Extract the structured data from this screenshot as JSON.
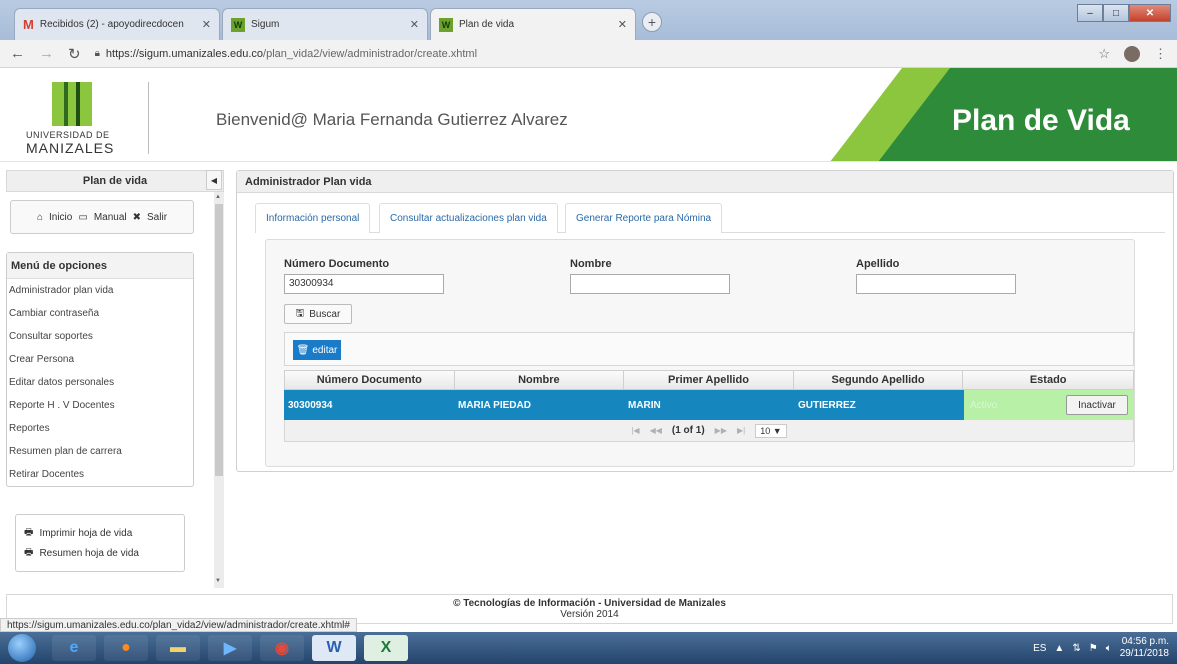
{
  "browser": {
    "tabs": [
      {
        "title": "Recibidos (2) - apoyodirecdocen"
      },
      {
        "title": "Sigum"
      },
      {
        "title": "Plan de vida"
      }
    ],
    "url_host": "https://sigum.umanizales.edu.co",
    "url_path": "/plan_vida2/view/administrador/create.xhtml"
  },
  "header": {
    "logo_line1": "UNIVERSIDAD DE",
    "logo_line2": "MANIZALES",
    "welcome": "Bienvenid@ Maria Fernanda Gutierrez Alvarez",
    "banner_title": "Plan de Vida"
  },
  "sidebar": {
    "title": "Plan de vida",
    "quick": {
      "inicio": "Inicio",
      "manual": "Manual",
      "salir": "Salir"
    },
    "menu_title": "Menú de opciones",
    "items": [
      "Administrador plan vida",
      "Cambiar contraseña",
      "Consultar soportes",
      "Crear Persona",
      "Editar datos personales",
      "Reporte H . V Docentes",
      "Reportes",
      "Resumen plan de carrera",
      "Retirar Docentes"
    ],
    "print_cv": "Imprimir hoja de vida",
    "summary_cv": "Resumen hoja de vida"
  },
  "panel": {
    "title": "Administrador Plan vida",
    "tabs": [
      "Información personal",
      "Consultar actualizaciones plan vida",
      "Generar Reporte para Nómina"
    ]
  },
  "form": {
    "doc_label": "Número Documento",
    "doc_value": "30300934",
    "name_label": "Nombre",
    "name_value": "",
    "surname_label": "Apellido",
    "surname_value": "",
    "search_label": "Buscar",
    "edit_label": "editar"
  },
  "table": {
    "columns": [
      "Número Documento",
      "Nombre",
      "Primer Apellido",
      "Segundo Apellido",
      "Estado"
    ],
    "rows": [
      {
        "documento": "30300934",
        "nombre": "MARIA PIEDAD",
        "primer_apellido": "MARIN",
        "segundo_apellido": "GUTIERREZ",
        "estado": "Activo",
        "action": "Inactivar"
      }
    ],
    "pager_text": "(1 of 1)",
    "rows_per_page": "10 ▼"
  },
  "footer": {
    "line1": "© Tecnologías de Información - Universidad de Manizales",
    "line2": "Versión 2014"
  },
  "status_url": "https://sigum.umanizales.edu.co/plan_vida2/view/administrador/create.xhtml#",
  "taskbar": {
    "lang": "ES",
    "time": "04:56 p.m.",
    "date": "29/11/2018"
  },
  "colors": {
    "accent": "#1686bf",
    "brand_green": "#2e8b3a",
    "status_active": "#b8f0a8"
  }
}
